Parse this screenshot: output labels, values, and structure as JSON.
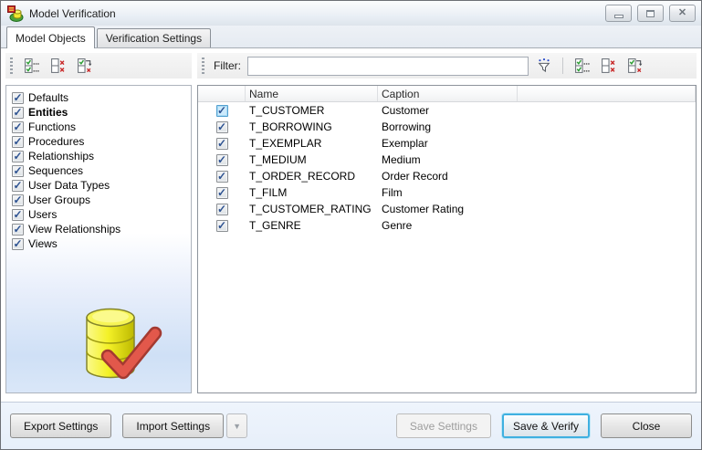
{
  "window": {
    "title": "Model Verification"
  },
  "tabs": [
    {
      "label": "Model Objects",
      "active": true
    },
    {
      "label": "Verification Settings",
      "active": false
    }
  ],
  "left_panel": {
    "selected_type": "Entities",
    "toolbar_icons": [
      "check-all",
      "uncheck-all",
      "invert-checks"
    ],
    "items": [
      {
        "label": "Defaults",
        "checked": true
      },
      {
        "label": "Entities",
        "checked": true
      },
      {
        "label": "Functions",
        "checked": true
      },
      {
        "label": "Procedures",
        "checked": true
      },
      {
        "label": "Relationships",
        "checked": true
      },
      {
        "label": "Sequences",
        "checked": true
      },
      {
        "label": "User Data Types",
        "checked": true
      },
      {
        "label": "User Groups",
        "checked": true
      },
      {
        "label": "Users",
        "checked": true
      },
      {
        "label": "View Relationships",
        "checked": true
      },
      {
        "label": "Views",
        "checked": true
      }
    ]
  },
  "filter": {
    "label": "Filter:",
    "value": ""
  },
  "table": {
    "headers": {
      "name": "Name",
      "caption": "Caption"
    },
    "focused_row_index": 0,
    "rows": [
      {
        "checked": true,
        "name": "T_CUSTOMER",
        "caption": "Customer"
      },
      {
        "checked": true,
        "name": "T_BORROWING",
        "caption": "Borrowing"
      },
      {
        "checked": true,
        "name": "T_EXEMPLAR",
        "caption": "Exemplar"
      },
      {
        "checked": true,
        "name": "T_MEDIUM",
        "caption": "Medium"
      },
      {
        "checked": true,
        "name": "T_ORDER_RECORD",
        "caption": "Order Record"
      },
      {
        "checked": true,
        "name": "T_FILM",
        "caption": "Film"
      },
      {
        "checked": true,
        "name": "T_CUSTOMER_RATING",
        "caption": "Customer Rating"
      },
      {
        "checked": true,
        "name": "T_GENRE",
        "caption": "Genre"
      }
    ]
  },
  "footer": {
    "export_label": "Export Settings",
    "import_label": "Import Settings",
    "save_settings_label": "Save Settings",
    "save_verify_label": "Save & Verify",
    "close_label": "Close"
  },
  "colors": {
    "default_button_border": "#3fb0e0",
    "check_blue": "#2d5291",
    "db_yellow": "#f4f127",
    "verify_check_red": "#e2584b"
  },
  "check_glyph": "✓"
}
